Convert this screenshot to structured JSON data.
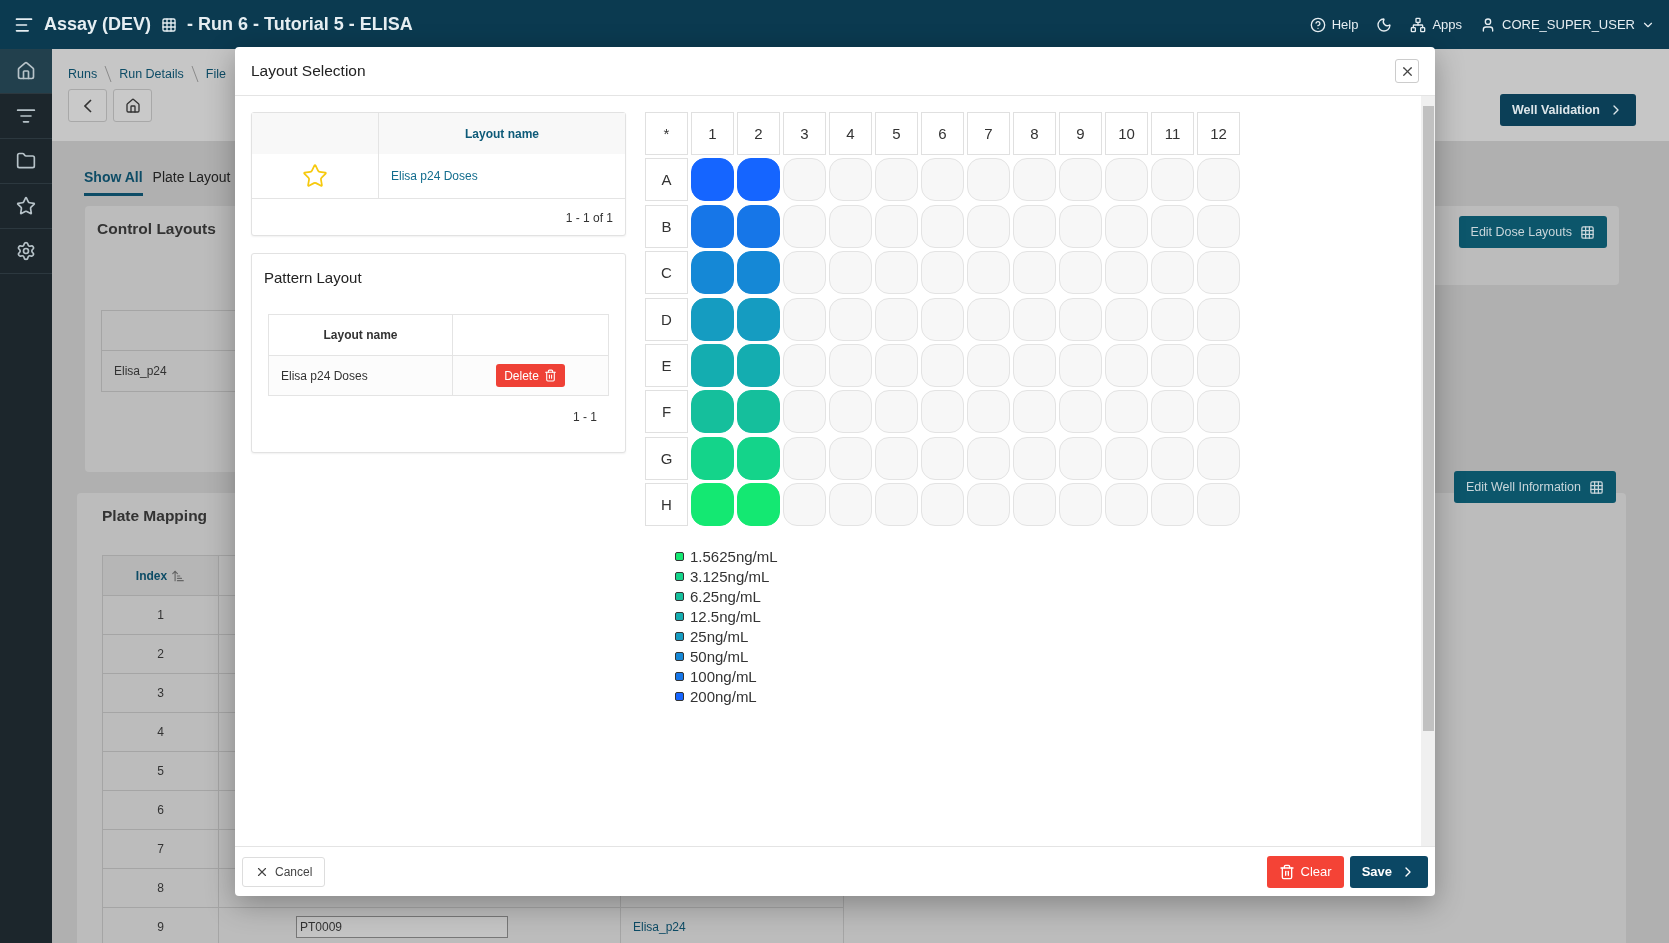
{
  "app_bar": {
    "title": "Assay (DEV)",
    "subtitle": "- Run 6 - Tutorial 5 - ELISA",
    "help": "Help",
    "apps": "Apps",
    "user": "CORE_SUPER_USER"
  },
  "sidebar": {
    "items": [
      {
        "kind": "home",
        "selected": true
      },
      {
        "kind": "list",
        "selected": false
      },
      {
        "kind": "folder",
        "selected": false
      },
      {
        "kind": "star",
        "selected": false
      },
      {
        "kind": "settings",
        "selected": false
      }
    ]
  },
  "breadcrumb": [
    "Runs",
    "Run Details",
    "File"
  ],
  "well_validation_button": "Well Validation",
  "tabs": [
    {
      "label": "Show All",
      "selected": true
    },
    {
      "label": "Plate Layout",
      "selected": false
    }
  ],
  "control_layouts": {
    "title": "Control Layouts",
    "rows": [
      "Elisa_p24"
    ],
    "button": "Edit Dose Layouts"
  },
  "plate_mapping": {
    "title": "Plate Mapping",
    "button": "Edit Well Information",
    "columns": [
      "Index"
    ],
    "rows": [
      {
        "index": "1"
      },
      {
        "index": "2"
      },
      {
        "index": "3"
      },
      {
        "index": "4"
      },
      {
        "index": "5"
      },
      {
        "index": "6"
      },
      {
        "index": "7"
      },
      {
        "index": "8"
      },
      {
        "index": "9",
        "plate_id": "PT0009",
        "layout": "Elisa_p24"
      }
    ]
  },
  "dialog": {
    "title": "Layout Selection",
    "layouts_table": {
      "columns": [
        "Layout name"
      ],
      "rows": [
        {
          "name": "Elisa p24 Doses"
        }
      ],
      "pagination": "1 - 1 of 1"
    },
    "pattern_layout": {
      "title": "Pattern Layout",
      "columns": [
        "Layout name"
      ],
      "rows": [
        {
          "name": "Elisa p24 Doses",
          "action": "Delete"
        }
      ],
      "pagination": "1 - 1"
    },
    "plate": {
      "corner": "*",
      "columns": [
        "1",
        "2",
        "3",
        "4",
        "5",
        "6",
        "7",
        "8",
        "9",
        "10",
        "11",
        "12"
      ],
      "rows": [
        {
          "label": "A",
          "filled": [
            true,
            true,
            false,
            false,
            false,
            false,
            false,
            false,
            false,
            false,
            false,
            false
          ],
          "color": "#1565ff"
        },
        {
          "label": "B",
          "filled": [
            true,
            true,
            false,
            false,
            false,
            false,
            false,
            false,
            false,
            false,
            false,
            false
          ],
          "color": "#1676e8"
        },
        {
          "label": "C",
          "filled": [
            true,
            true,
            false,
            false,
            false,
            false,
            false,
            false,
            false,
            false,
            false,
            false
          ],
          "color": "#1588d6"
        },
        {
          "label": "D",
          "filled": [
            true,
            true,
            false,
            false,
            false,
            false,
            false,
            false,
            false,
            false,
            false,
            false
          ],
          "color": "#159cc1"
        },
        {
          "label": "E",
          "filled": [
            true,
            true,
            false,
            false,
            false,
            false,
            false,
            false,
            false,
            false,
            false,
            false
          ],
          "color": "#14adb0"
        },
        {
          "label": "F",
          "filled": [
            true,
            true,
            false,
            false,
            false,
            false,
            false,
            false,
            false,
            false,
            false,
            false
          ],
          "color": "#15bf9c"
        },
        {
          "label": "G",
          "filled": [
            true,
            true,
            false,
            false,
            false,
            false,
            false,
            false,
            false,
            false,
            false,
            false
          ],
          "color": "#14d48a"
        },
        {
          "label": "H",
          "filled": [
            true,
            true,
            false,
            false,
            false,
            false,
            false,
            false,
            false,
            false,
            false,
            false
          ],
          "color": "#14e872"
        }
      ]
    },
    "legend": [
      {
        "label": "1.5625ng/mL",
        "color": "#14e872"
      },
      {
        "label": "3.125ng/mL",
        "color": "#14d48a"
      },
      {
        "label": "6.25ng/mL",
        "color": "#15bf9c"
      },
      {
        "label": "12.5ng/mL",
        "color": "#14adb0"
      },
      {
        "label": "25ng/mL",
        "color": "#159cc1"
      },
      {
        "label": "50ng/mL",
        "color": "#1588d6"
      },
      {
        "label": "100ng/mL",
        "color": "#1676e8"
      },
      {
        "label": "200ng/mL",
        "color": "#1565ff"
      }
    ],
    "buttons": {
      "cancel": "Cancel",
      "clear": "Clear",
      "save": "Save"
    }
  }
}
